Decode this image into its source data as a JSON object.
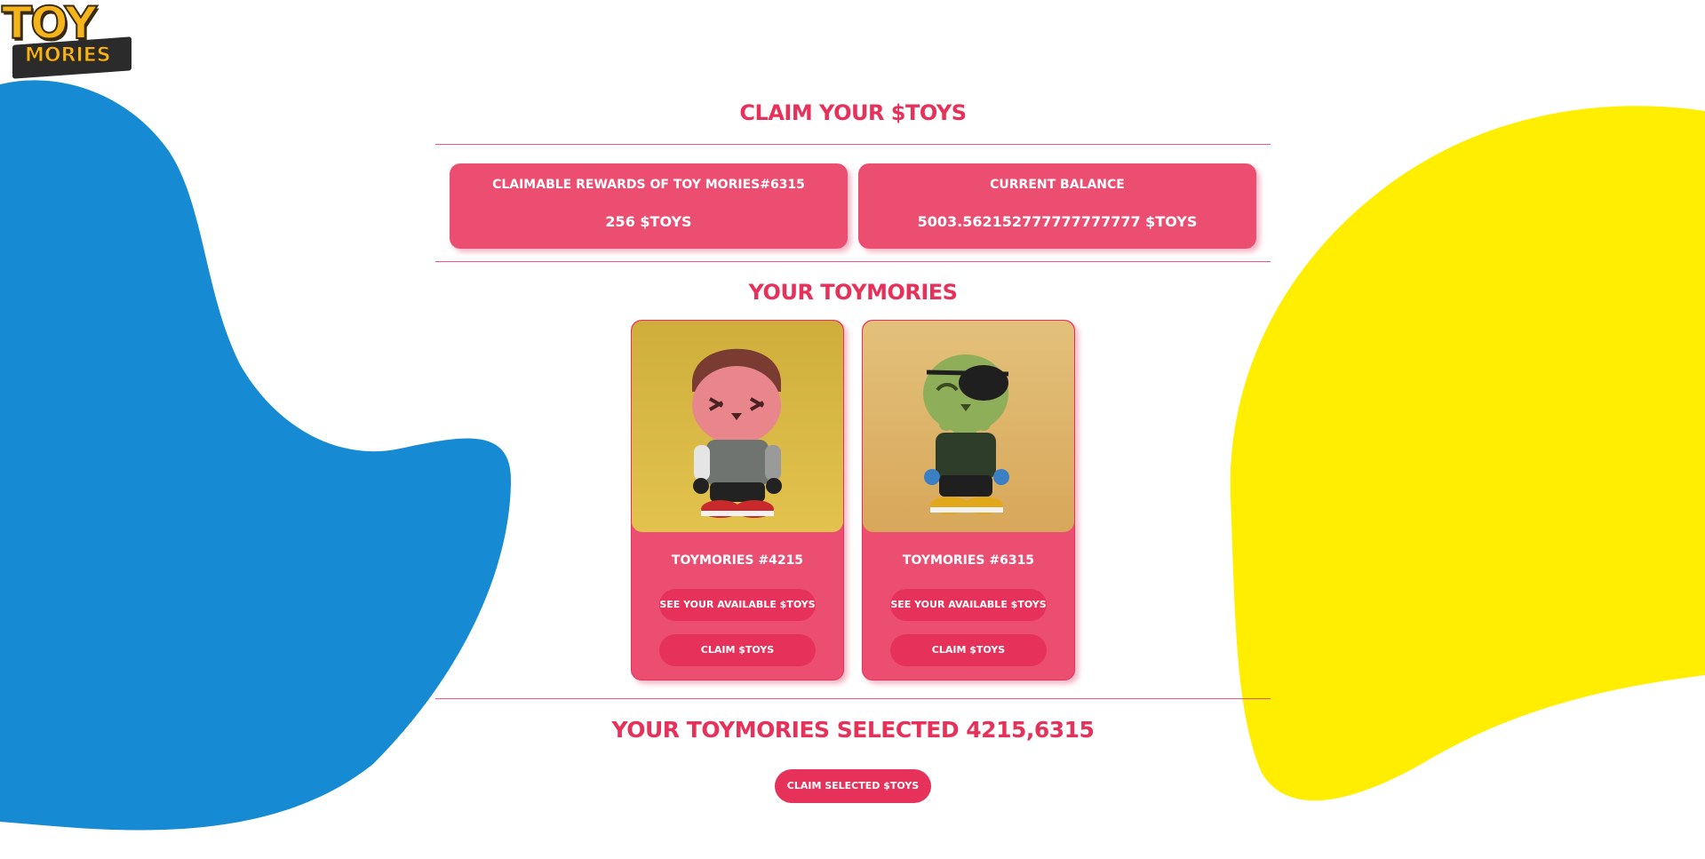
{
  "logo": {
    "top_text": "TOY",
    "bottom_text": "MORIES"
  },
  "claim_section": {
    "title": "CLAIM YOUR $TOYS",
    "rewards_label": "CLAIMABLE REWARDS OF TOY MORIES#6315",
    "rewards_value": "256 $TOYS",
    "balance_label": "CURRENT BALANCE",
    "balance_value": "5003.562152777777777777 $TOYS"
  },
  "toys_section": {
    "title": "YOUR TOYMORIES",
    "cards": [
      {
        "name": "TOYMORIES #4215",
        "see_label": "SEE YOUR AVAILABLE $TOYS",
        "claim_label": "CLAIM $TOYS"
      },
      {
        "name": "TOYMORIES #6315",
        "see_label": "SEE YOUR AVAILABLE $TOYS",
        "claim_label": "CLAIM $TOYS"
      }
    ]
  },
  "selected_section": {
    "title": "YOUR TOYMORIES SELECTED 4215,6315",
    "claim_label": "CLAIM SELECTED $TOYS"
  },
  "colors": {
    "accent": "#e6325a",
    "card": "#ec4e72",
    "blue_blob": "#168bd3",
    "yellow_blob": "#ffee00"
  }
}
